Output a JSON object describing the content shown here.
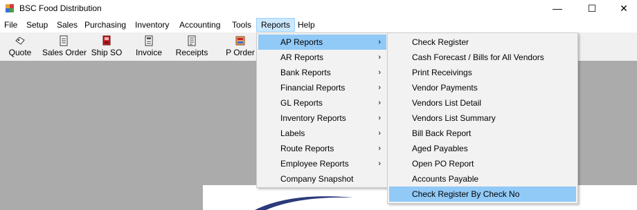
{
  "window": {
    "title": "BSC Food Distribution",
    "icons": {
      "app": "app-icon",
      "minimize": "minimize-icon",
      "maximize": "maximize-icon",
      "close": "close-icon"
    },
    "controls": {
      "minimize": "—",
      "maximize": "☐",
      "close": "✕"
    }
  },
  "menubar": {
    "items": [
      {
        "label": "File"
      },
      {
        "label": "Setup"
      },
      {
        "label": "Sales"
      },
      {
        "label": "Purchasing"
      },
      {
        "label": "Inventory"
      },
      {
        "label": "Accounting"
      },
      {
        "label": "Tools"
      },
      {
        "label": "Reports",
        "active": true
      },
      {
        "label": "Help"
      }
    ]
  },
  "toolbar": {
    "items": [
      {
        "label": "Quote",
        "icon": "quote-icon"
      },
      {
        "label": "Sales Order",
        "icon": "sales-order-icon"
      },
      {
        "label": "Ship SO",
        "icon": "ship-so-icon"
      },
      {
        "label": "Invoice",
        "icon": "invoice-icon"
      },
      {
        "label": "Receipts",
        "icon": "receipts-icon"
      },
      {
        "label": "P Order",
        "icon": "p-order-icon"
      }
    ]
  },
  "reports_menu": {
    "items": [
      {
        "label": "AP Reports",
        "submenu": true,
        "highlighted": true
      },
      {
        "label": "AR Reports",
        "submenu": true
      },
      {
        "label": "Bank Reports",
        "submenu": true
      },
      {
        "label": "Financial Reports",
        "submenu": true
      },
      {
        "label": "GL Reports",
        "submenu": true
      },
      {
        "label": "Inventory Reports",
        "submenu": true
      },
      {
        "label": "Labels",
        "submenu": true
      },
      {
        "label": "Route Reports",
        "submenu": true
      },
      {
        "label": "Employee Reports",
        "submenu": true
      },
      {
        "label": "Company Snapshot",
        "submenu": false
      }
    ],
    "arrow_glyph": "›"
  },
  "ap_reports_menu": {
    "items": [
      {
        "label": "Check Register"
      },
      {
        "label": "Cash Forecast / Bills for All Vendors"
      },
      {
        "label": "Print Receivings"
      },
      {
        "label": "Vendor Payments"
      },
      {
        "label": "Vendors List Detail"
      },
      {
        "label": "Vendors List Summary"
      },
      {
        "label": "Bill Back Report"
      },
      {
        "label": "Aged Payables"
      },
      {
        "label": "Open PO Report"
      },
      {
        "label": "Accounts Payable"
      },
      {
        "label": "Check Register By Check No",
        "highlighted": true
      }
    ]
  },
  "colors": {
    "menu_highlight": "#91c9f7",
    "menubar_active": "#cce8ff",
    "workspace": "#ababab"
  }
}
